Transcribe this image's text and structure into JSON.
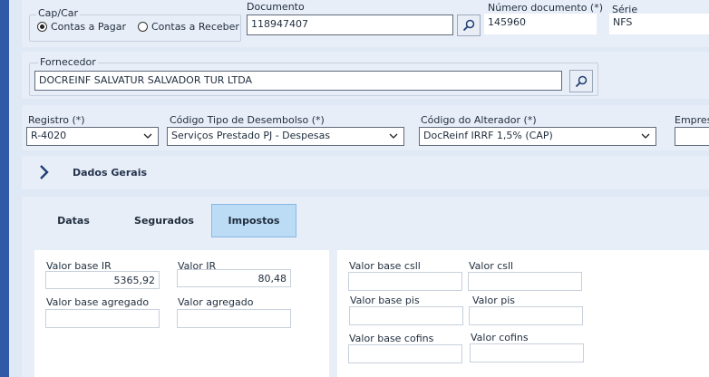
{
  "capcar": {
    "title": "Cap/Car",
    "option_pagar": "Contas a Pagar",
    "option_receber": "Contas a Receber",
    "selected": "pagar"
  },
  "documento": {
    "label": "Documento",
    "value": "118947407"
  },
  "numero_documento": {
    "label": "Número documento (*)",
    "value": "145960"
  },
  "serie": {
    "label": "Série",
    "value": "NFS"
  },
  "fornecedor": {
    "title": "Fornecedor",
    "value": "DOCREINF SALVATUR SALVADOR TUR LTDA"
  },
  "registro": {
    "label": "Registro (*)",
    "value": "R-4020"
  },
  "tipo_desembolso": {
    "label": "Código Tipo de Desembolso (*)",
    "value": "Serviços Prestado PJ - Despesas"
  },
  "alterador": {
    "label": "Código do Alterador (*)",
    "value": "DocReinf IRRF 1,5% (CAP)"
  },
  "empresa": {
    "label": "Empres"
  },
  "dados_gerais": {
    "label": "Dados Gerais"
  },
  "tabs": [
    {
      "label": "Datas",
      "active": false
    },
    {
      "label": "Segurados",
      "active": false
    },
    {
      "label": "Impostos",
      "active": true
    }
  ],
  "impostos": {
    "valor_base_ir": {
      "label": "Valor base IR",
      "value": "5365,92"
    },
    "valor_ir": {
      "label": "Valor IR",
      "value": "80,48"
    },
    "valor_base_agregado": {
      "label": "Valor base agregado",
      "value": ""
    },
    "valor_agregado": {
      "label": "Valor agregado",
      "value": ""
    },
    "valor_base_csll": {
      "label": "Valor base csll",
      "value": ""
    },
    "valor_csll": {
      "label": "Valor csll",
      "value": ""
    },
    "valor_base_pis": {
      "label": "Valor base pis",
      "value": ""
    },
    "valor_pis": {
      "label": "Valor pis",
      "value": ""
    },
    "valor_base_cofins": {
      "label": "Valor base cofins",
      "value": ""
    },
    "valor_cofins": {
      "label": "Valor cofins",
      "value": ""
    }
  }
}
